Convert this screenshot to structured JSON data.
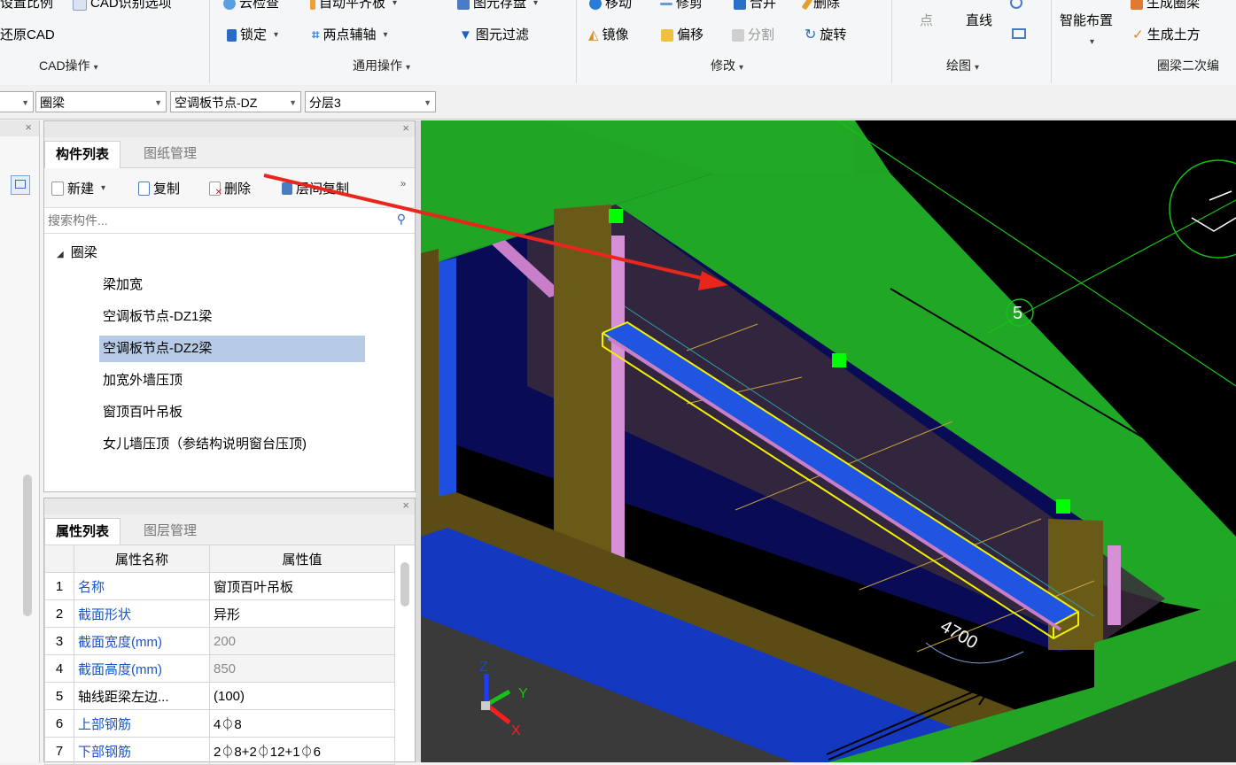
{
  "ribbon": {
    "row1": {
      "set_scale": "设置比例",
      "cad_options": "CAD识别选项",
      "cloud_check": "云检查",
      "auto_flush": "自动平齐板",
      "save_element": "图元存盘",
      "move": "移动",
      "trim": "修剪",
      "merge": "合并",
      "delete": "删除",
      "smart_layout": "智能布置",
      "gen_ring_beam": "生成圈梁"
    },
    "row2": {
      "restore_cad": "还原CAD",
      "lock": "锁定",
      "two_point_axis": "两点辅轴",
      "element_filter": "图元过滤",
      "mirror": "镜像",
      "offset": "偏移",
      "split": "分割",
      "rotate": "旋转",
      "point": "点",
      "line": "直线",
      "gen_earthwork": "生成土方"
    },
    "groups": {
      "cad_ops": "CAD操作",
      "common_ops": "通用操作",
      "modify": "修改",
      "draw": "绘图",
      "ring_beam_edit": "圈梁二次编"
    }
  },
  "selectors": {
    "type": "圈梁",
    "component": "空调板节点-DZ",
    "layer": "分层3"
  },
  "component_panel": {
    "tab_active": "构件列表",
    "tab_inactive": "图纸管理",
    "toolbar": {
      "new": "新建",
      "copy": "复制",
      "delete": "删除",
      "floor_copy": "层间复制"
    },
    "search_placeholder": "搜索构件...",
    "tree": {
      "root": "圈梁",
      "items": [
        "梁加宽",
        "空调板节点-DZ1梁",
        "空调板节点-DZ2梁",
        "加宽外墙压顶",
        "窗顶百叶吊板",
        "女儿墙压顶（参结构说明窗台压顶)"
      ],
      "selected_index": 2
    }
  },
  "property_panel": {
    "tab_active": "属性列表",
    "tab_inactive": "图层管理",
    "col_name": "属性名称",
    "col_value": "属性值",
    "rows": [
      {
        "no": "1",
        "name": "名称",
        "value": "窗顶百叶吊板"
      },
      {
        "no": "2",
        "name": "截面形状",
        "value": "异形"
      },
      {
        "no": "3",
        "name": "截面宽度(mm)",
        "value": "200"
      },
      {
        "no": "4",
        "name": "截面高度(mm)",
        "value": "850"
      },
      {
        "no": "5",
        "name": "轴线距梁左边...",
        "value": "(100)"
      },
      {
        "no": "6",
        "name": "上部钢筋",
        "value": "4⏀8"
      },
      {
        "no": "7",
        "name": "下部钢筋",
        "value": "2⏀8+2⏀12+1⏀6"
      }
    ]
  },
  "viewport": {
    "axis_label": "5",
    "dimension": "4700",
    "axes": {
      "x": "X",
      "y": "Y",
      "z": "Z"
    }
  },
  "colors": {
    "green_slab": "#22a624",
    "beam_blue": "#1f55e0",
    "highlight": "#f2f200",
    "arrow_red": "#e8261b"
  }
}
